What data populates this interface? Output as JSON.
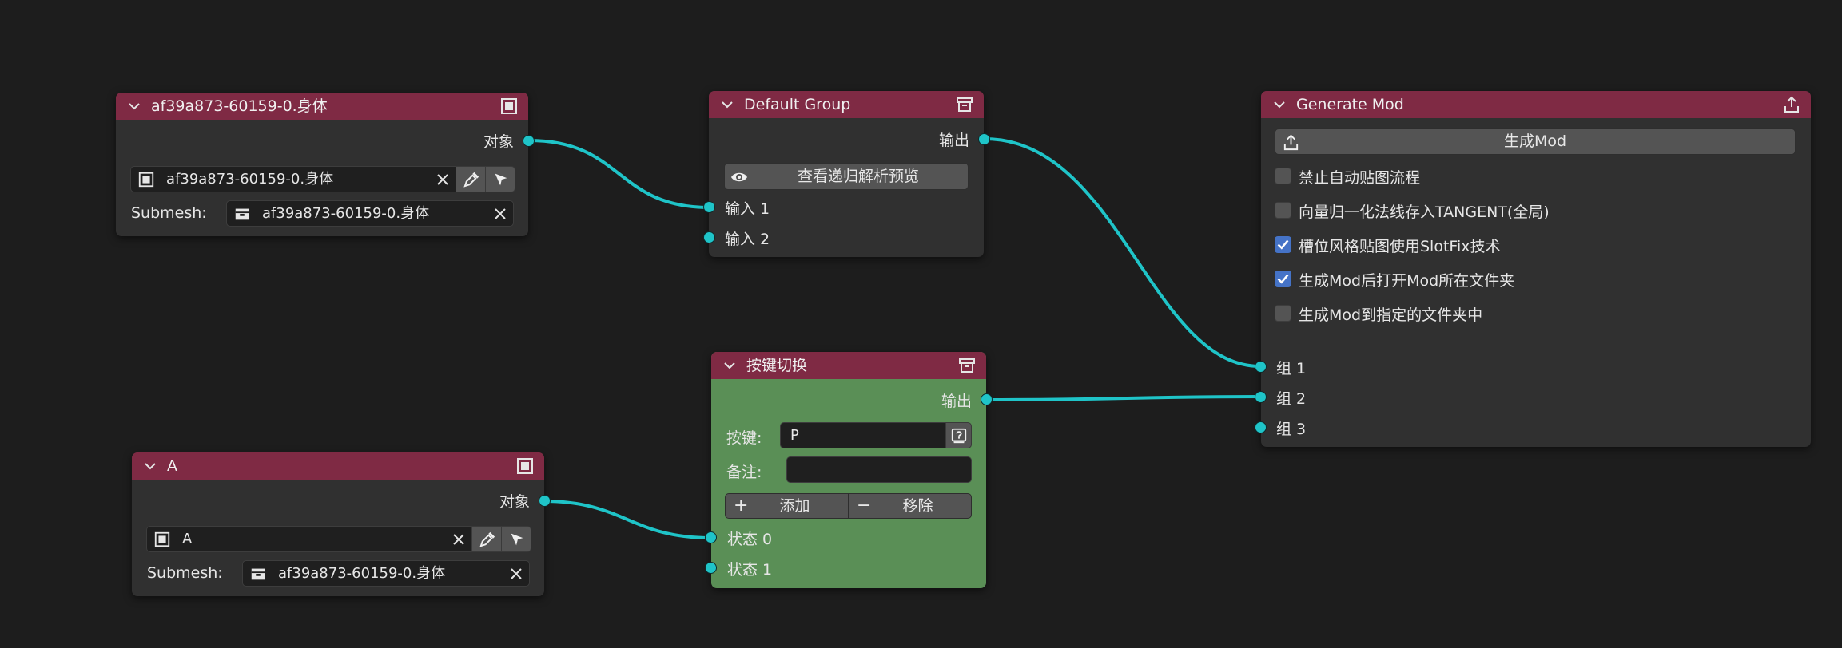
{
  "colors": {
    "canvas_bg": "#1d1d1d",
    "node_bg": "#303030",
    "node_header": "#7f2a44",
    "green_node_bg": "#5a8f56",
    "socket": "#1fc4c8",
    "wire": "#1fc4c8",
    "checkbox_on": "#4573c7",
    "field_bg": "#1f1f1f",
    "button_bg": "#545454"
  },
  "node_body": {
    "title": "af39a873-60159-0.身体",
    "output_label": "对象",
    "object_value": "af39a873-60159-0.身体",
    "submesh_label": "Submesh:",
    "submesh_value": "af39a873-60159-0.身体"
  },
  "node_a": {
    "title": "A",
    "output_label": "对象",
    "object_value": "A",
    "submesh_label": "Submesh:",
    "submesh_value": "af39a873-60159-0.身体"
  },
  "node_default_group": {
    "title": "Default Group",
    "output_label": "输出",
    "preview_button": "查看递归解析预览",
    "inputs": [
      "输入 1",
      "输入 2"
    ]
  },
  "node_key_switch": {
    "title": "按键切换",
    "output_label": "输出",
    "key_label": "按键:",
    "key_value": "P",
    "note_label": "备注:",
    "note_value": "",
    "add_button": "添加",
    "add_symbol": "+",
    "remove_button": "移除",
    "remove_symbol": "−",
    "states": [
      "状态 0",
      "状态 1"
    ]
  },
  "node_generate_mod": {
    "title": "Generate Mod",
    "generate_button": "生成Mod",
    "options": [
      {
        "label": "禁止自动贴图流程",
        "checked": false
      },
      {
        "label": "向量归一化法线存入TANGENT(全局)",
        "checked": false
      },
      {
        "label": "槽位风格贴图使用SlotFix技术",
        "checked": true
      },
      {
        "label": "生成Mod后打开Mod所在文件夹",
        "checked": true
      },
      {
        "label": "生成Mod到指定的文件夹中",
        "checked": false
      }
    ],
    "groups": [
      "组 1",
      "组 2",
      "组 3"
    ]
  },
  "icons": {
    "collapse": "chevron-down-icon",
    "object_header": "object-frame-icon",
    "group_header": "archive-box-icon",
    "export_header": "export-icon",
    "eyedropper": "eyedropper-icon",
    "cursor": "cursor-pointer-icon",
    "clear": "close-icon",
    "mesh": "mesh-data-icon",
    "eye": "eye-icon",
    "keyboard": "keyboard-help-icon",
    "upload": "upload-icon"
  },
  "links": [
    {
      "from": "node_body.output",
      "to": "node_default_group.input_1"
    },
    {
      "from": "node_a.output",
      "to": "node_key_switch.state_0"
    },
    {
      "from": "node_default_group.output",
      "to": "node_generate_mod.group_1"
    },
    {
      "from": "node_key_switch.output",
      "to": "node_generate_mod.group_2"
    }
  ]
}
